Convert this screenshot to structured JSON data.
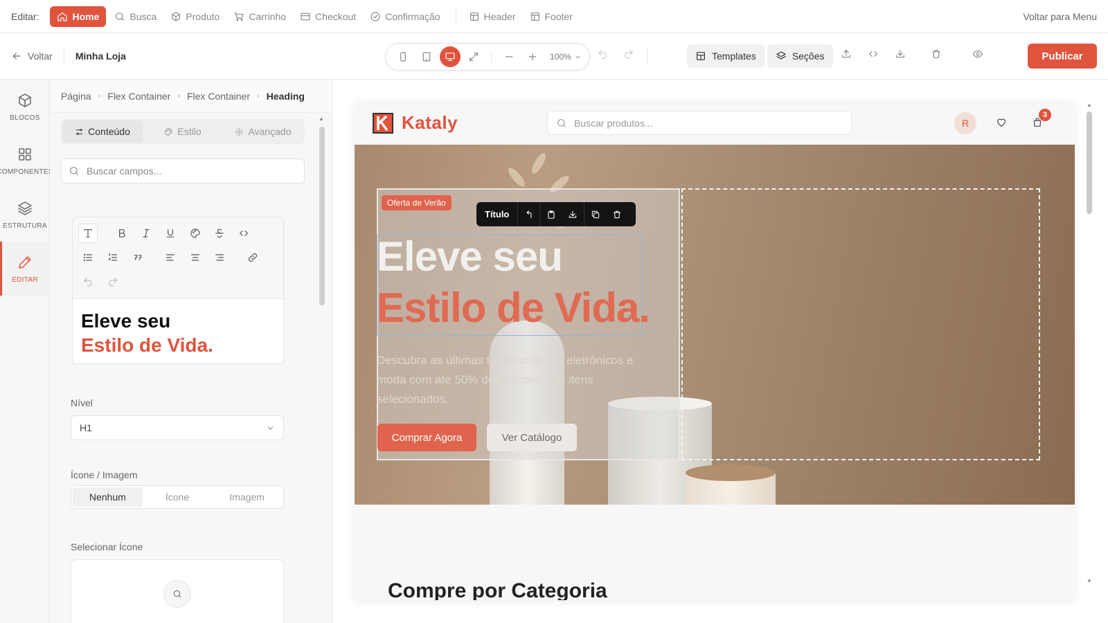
{
  "topnav": {
    "label": "Editar:",
    "items": [
      {
        "label": "Home",
        "icon": "home-icon",
        "active": true
      },
      {
        "label": "Busca",
        "icon": "search-icon"
      },
      {
        "label": "Produto",
        "icon": "box-icon"
      },
      {
        "label": "Carrinho",
        "icon": "cart-icon"
      },
      {
        "label": "Checkout",
        "icon": "card-icon"
      },
      {
        "label": "Confirmação",
        "icon": "check-circle-icon"
      }
    ],
    "layout_items": [
      {
        "label": "Header",
        "icon": "layout-icon"
      },
      {
        "label": "Footer",
        "icon": "layout-icon"
      }
    ],
    "back_to_menu": "Voltar para Menu"
  },
  "toolbar": {
    "back": "Voltar",
    "store_name": "Minha Loja",
    "zoom": "100%",
    "active_device": "desktop",
    "templates": "Templates",
    "sections": "Seções",
    "publish": "Publicar"
  },
  "rail": {
    "items": [
      {
        "label": "BLOCOS",
        "icon": "cube-icon"
      },
      {
        "label": "COMPONENTES",
        "icon": "grid-icon"
      },
      {
        "label": "ESTRUTURA",
        "icon": "layers-icon"
      },
      {
        "label": "EDITAR",
        "icon": "pencil-icon",
        "active": true
      }
    ]
  },
  "panel": {
    "breadcrumb": [
      "Página",
      "Flex Container",
      "Flex Container",
      "Heading"
    ],
    "tabs": [
      {
        "label": "Conteúdo",
        "icon": "sliders-icon",
        "active": true
      },
      {
        "label": "Estilo",
        "icon": "palette-icon"
      },
      {
        "label": "Avançado",
        "icon": "gear-icon"
      }
    ],
    "search_placeholder": "Buscar campos...",
    "editor_line1": "Eleve seu",
    "editor_line2": "Estilo de Vida.",
    "level_label": "Nível",
    "level_value": "H1",
    "icon_image_label": "Ícone / Imagem",
    "icon_image_options": [
      "Nenhum",
      "Ícone",
      "Imagem"
    ],
    "icon_image_selected": "Nenhum",
    "select_icon_label": "Selecionar Ícone"
  },
  "site": {
    "brand": "Kataly",
    "search_placeholder": "Buscar produtos...",
    "avatar_initial": "R",
    "cart_count": "3",
    "offer_badge": "Oferta de Verão",
    "element_toolbar_name": "Título",
    "headline_line1": "Eleve seu",
    "headline_line2": "Estilo de Vida.",
    "description": "Descubra as últimas tendências em eletrônicos e moda com até 50% de desconto em itens selecionados.",
    "cta_primary": "Comprar Agora",
    "cta_secondary": "Ver Catálogo",
    "section_heading": "Compre por Categoria"
  },
  "colors": {
    "accent": "#e0533d",
    "hero_text": "#f2f0ed",
    "hero_accent_text": "#e06a52"
  }
}
